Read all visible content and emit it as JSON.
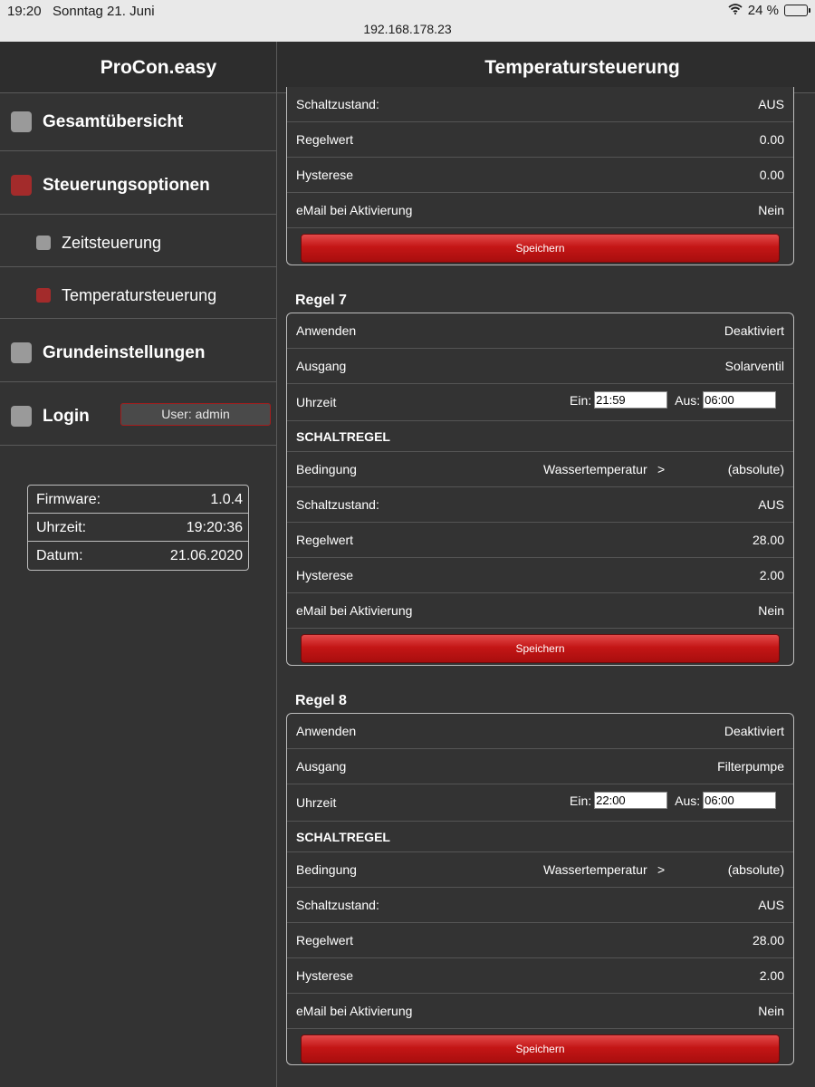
{
  "status_bar": {
    "time": "19:20",
    "date": "Sonntag 21. Juni",
    "url": "192.168.178.23",
    "battery": "24 %",
    "battery_level": 0.24
  },
  "header": {
    "brand": "ProCon.easy",
    "page_title": "Temperatursteuerung"
  },
  "sidebar": {
    "items": [
      {
        "label": "Gesamtübersicht",
        "active": false
      },
      {
        "label": "Steuerungsoptionen",
        "active": true
      },
      {
        "label": "Zeitsteuerung",
        "active": false
      },
      {
        "label": "Temperatursteuerung",
        "active": true
      },
      {
        "label": "Grundeinstellungen",
        "active": false
      },
      {
        "label": "Login",
        "active": false
      }
    ],
    "user_button": "User: admin",
    "info": [
      {
        "label": "Firmware:",
        "value": "1.0.4"
      },
      {
        "label": "Uhrzeit:",
        "value": "19:20:36"
      },
      {
        "label": "Datum:",
        "value": "21.06.2020"
      }
    ]
  },
  "colors": {
    "accent_red": "#c41616",
    "background": "#333333",
    "inactive_square": "#9a9a9a"
  },
  "partial_rule": {
    "rows": [
      {
        "label": "Schaltzustand:",
        "value": "AUS"
      },
      {
        "label": "Regelwert",
        "value": "0.00"
      },
      {
        "label": "Hysterese",
        "value": "0.00"
      },
      {
        "label": "eMail bei Aktivierung",
        "value": "Nein"
      }
    ],
    "save": "Speichern"
  },
  "rules": [
    {
      "title": "Regel 7",
      "apply_label": "Anwenden",
      "apply_value": "Deaktiviert",
      "output_label": "Ausgang",
      "output_value": "Solarventil",
      "time_label": "Uhrzeit",
      "on_label": "Ein:",
      "on_value": "21:59",
      "off_label": "Aus:",
      "off_value": "06:00",
      "section": "SCHALTREGEL",
      "cond_label": "Bedingung",
      "cond_value": "Wassertemperatur",
      "cond_op": ">",
      "cond_mode": "(absolute)",
      "state_label": "Schaltzustand:",
      "state_value": "AUS",
      "setpoint_label": "Regelwert",
      "setpoint_value": "28.00",
      "hyst_label": "Hysterese",
      "hyst_value": "2.00",
      "email_label": "eMail bei Aktivierung",
      "email_value": "Nein",
      "save": "Speichern"
    },
    {
      "title": "Regel 8",
      "apply_label": "Anwenden",
      "apply_value": "Deaktiviert",
      "output_label": "Ausgang",
      "output_value": "Filterpumpe",
      "time_label": "Uhrzeit",
      "on_label": "Ein:",
      "on_value": "22:00",
      "off_label": "Aus:",
      "off_value": "06:00",
      "section": "SCHALTREGEL",
      "cond_label": "Bedingung",
      "cond_value": "Wassertemperatur",
      "cond_op": ">",
      "cond_mode": "(absolute)",
      "state_label": "Schaltzustand:",
      "state_value": "AUS",
      "setpoint_label": "Regelwert",
      "setpoint_value": "28.00",
      "hyst_label": "Hysterese",
      "hyst_value": "2.00",
      "email_label": "eMail bei Aktivierung",
      "email_value": "Nein",
      "save": "Speichern"
    }
  ]
}
